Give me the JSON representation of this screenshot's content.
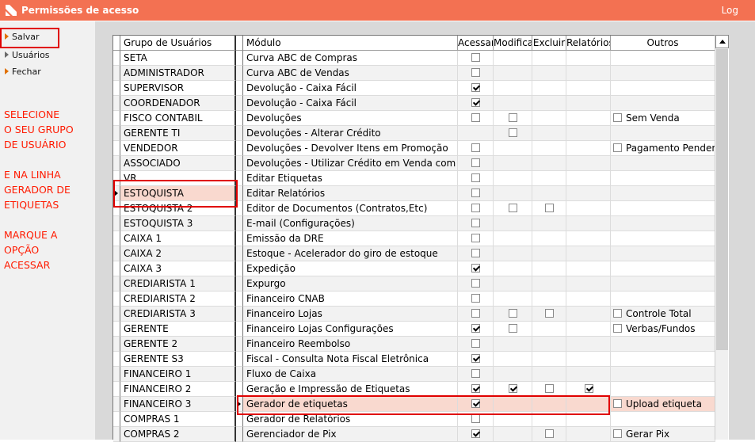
{
  "window": {
    "title": "Permissões de acesso",
    "log_label": "Log"
  },
  "sidebar": {
    "items": [
      {
        "label": "Salvar",
        "icon": "orange-triangle-icon"
      },
      {
        "label": "Usuários",
        "icon": "grey-triangle-icon"
      },
      {
        "label": "Fechar",
        "icon": "orange-triangle-icon"
      }
    ],
    "instructions": "SELECIONE\nO SEU GRUPO\nDE USUÁRIO\n\nE NA LINHA\nGERADOR DE\nETIQUETAS\n\nMARQUE A\nOPÇÃO\nACESSAR"
  },
  "grid": {
    "headers": {
      "group": "Grupo de Usuários",
      "module": "Módulo",
      "access": "Acessar",
      "modify": "Modifica",
      "delete": "Excluir",
      "reports": "Relatórios",
      "others": "Outros"
    },
    "rows": [
      {
        "group": "SETA",
        "module": "Curva ABC de Compras",
        "a": 0,
        "m": -1,
        "d": -1,
        "r": -1,
        "other": ""
      },
      {
        "group": "ADMINISTRADOR",
        "module": "Curva ABC de Vendas",
        "a": 0,
        "m": -1,
        "d": -1,
        "r": -1,
        "other": ""
      },
      {
        "group": "SUPERVISOR",
        "module": "Devolução - Caixa Fácil",
        "a": 1,
        "m": -1,
        "d": -1,
        "r": -1,
        "other": ""
      },
      {
        "group": "COORDENADOR",
        "module": "Devolução - Caixa Fácil",
        "a": 1,
        "m": -1,
        "d": -1,
        "r": -1,
        "other": ""
      },
      {
        "group": "FISCO CONTABIL",
        "module": "Devoluções",
        "a": 0,
        "m": 0,
        "d": -1,
        "r": -1,
        "other": "Sem Venda"
      },
      {
        "group": "GERENTE TI",
        "module": "Devoluções - Alterar Crédito",
        "a": -1,
        "m": 0,
        "d": -1,
        "r": -1,
        "other": ""
      },
      {
        "group": "VENDEDOR",
        "module": "Devoluções - Devolver Itens em Promoção",
        "a": 0,
        "m": -1,
        "d": -1,
        "r": -1,
        "other": "Pagamento Pendente"
      },
      {
        "group": "ASSOCIADO",
        "module": "Devoluções - Utilizar Crédito em Venda com Desconto",
        "a": 0,
        "m": -1,
        "d": -1,
        "r": -1,
        "other": ""
      },
      {
        "group": "VR",
        "module": "Editar Etiquetas",
        "a": 0,
        "m": -1,
        "d": -1,
        "r": -1,
        "other": ""
      },
      {
        "group": "ESTOQUISTA",
        "module": "Editar Relatórios",
        "a": 0,
        "m": -1,
        "d": -1,
        "r": -1,
        "other": "",
        "selected_group": true
      },
      {
        "group": "ESTOQUISTA 2",
        "module": "Editor de Documentos (Contratos,Etc)",
        "a": 0,
        "m": 0,
        "d": 0,
        "r": -1,
        "other": ""
      },
      {
        "group": "ESTOQUISTA 3",
        "module": "E-mail (Configurações)",
        "a": 0,
        "m": -1,
        "d": -1,
        "r": -1,
        "other": ""
      },
      {
        "group": "CAIXA 1",
        "module": "Emissão da DRE",
        "a": 0,
        "m": -1,
        "d": -1,
        "r": -1,
        "other": ""
      },
      {
        "group": "CAIXA 2",
        "module": "Estoque - Acelerador do giro de estoque",
        "a": 0,
        "m": -1,
        "d": -1,
        "r": -1,
        "other": ""
      },
      {
        "group": "CAIXA 3",
        "module": "Expedição",
        "a": 1,
        "m": -1,
        "d": -1,
        "r": -1,
        "other": ""
      },
      {
        "group": "CREDIARISTA 1",
        "module": "Expurgo",
        "a": 0,
        "m": -1,
        "d": -1,
        "r": -1,
        "other": ""
      },
      {
        "group": "CREDIARISTA 2",
        "module": "Financeiro CNAB",
        "a": 0,
        "m": -1,
        "d": -1,
        "r": -1,
        "other": ""
      },
      {
        "group": "CREDIARISTA 3",
        "module": "Financeiro Lojas",
        "a": 0,
        "m": 0,
        "d": 0,
        "r": -1,
        "other": "Controle Total"
      },
      {
        "group": "GERENTE",
        "module": "Financeiro Lojas Configurações",
        "a": 1,
        "m": 0,
        "d": -1,
        "r": -1,
        "other": "Verbas/Fundos"
      },
      {
        "group": "GERENTE 2",
        "module": "Financeiro Reembolso",
        "a": 0,
        "m": -1,
        "d": -1,
        "r": -1,
        "other": ""
      },
      {
        "group": "GERENTE S3",
        "module": "Fiscal - Consulta Nota Fiscal Eletrônica",
        "a": 1,
        "m": -1,
        "d": -1,
        "r": -1,
        "other": ""
      },
      {
        "group": "FINANCEIRO 1",
        "module": "Fluxo de Caixa",
        "a": 0,
        "m": -1,
        "d": -1,
        "r": -1,
        "other": ""
      },
      {
        "group": "FINANCEIRO 2",
        "module": "Geração e Impressão de Etiquetas",
        "a": 1,
        "m": 1,
        "d": 0,
        "r": 1,
        "other": ""
      },
      {
        "group": "FINANCEIRO 3",
        "module": "Gerador de etiquetas",
        "a": 1,
        "m": -1,
        "d": -1,
        "r": -1,
        "other": "Upload etiqueta",
        "selected_module": true
      },
      {
        "group": "COMPRAS 1",
        "module": "Gerador de Relatórios",
        "a": 0,
        "m": -1,
        "d": -1,
        "r": -1,
        "other": ""
      },
      {
        "group": "COMPRAS 2",
        "module": "Gerenciador de Pix",
        "a": 1,
        "m": -1,
        "d": 0,
        "r": -1,
        "other": "Gerar Pix"
      }
    ]
  }
}
